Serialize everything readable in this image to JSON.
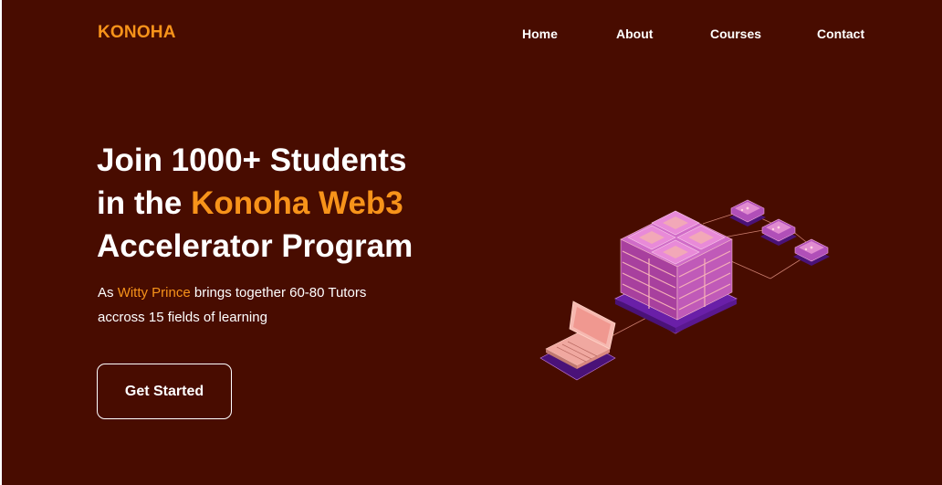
{
  "brand": {
    "name": "KONOHA"
  },
  "nav": {
    "items": [
      {
        "label": "Home"
      },
      {
        "label": "About"
      },
      {
        "label": "Courses"
      },
      {
        "label": "Contact"
      }
    ]
  },
  "hero": {
    "headline_line1": "Join 1000+ Students",
    "headline_line2_prefix": "in the ",
    "headline_line2_accent": "Konoha Web3",
    "headline_line3": "Accelerator Program",
    "sub_prefix": "As ",
    "sub_accent": "Witty Prince",
    "sub_line1_suffix": " brings together 60-80 Tutors",
    "sub_line2": "accross 15 fields of learning",
    "cta_label": "Get Started"
  },
  "colors": {
    "background": "#480c00",
    "accent": "#f7931a",
    "text": "#ffffff",
    "illustration_purple": "#b04fb8",
    "illustration_pink": "#f0a8a0"
  },
  "icons": {
    "illustration": "laptop-server-network-illustration"
  }
}
